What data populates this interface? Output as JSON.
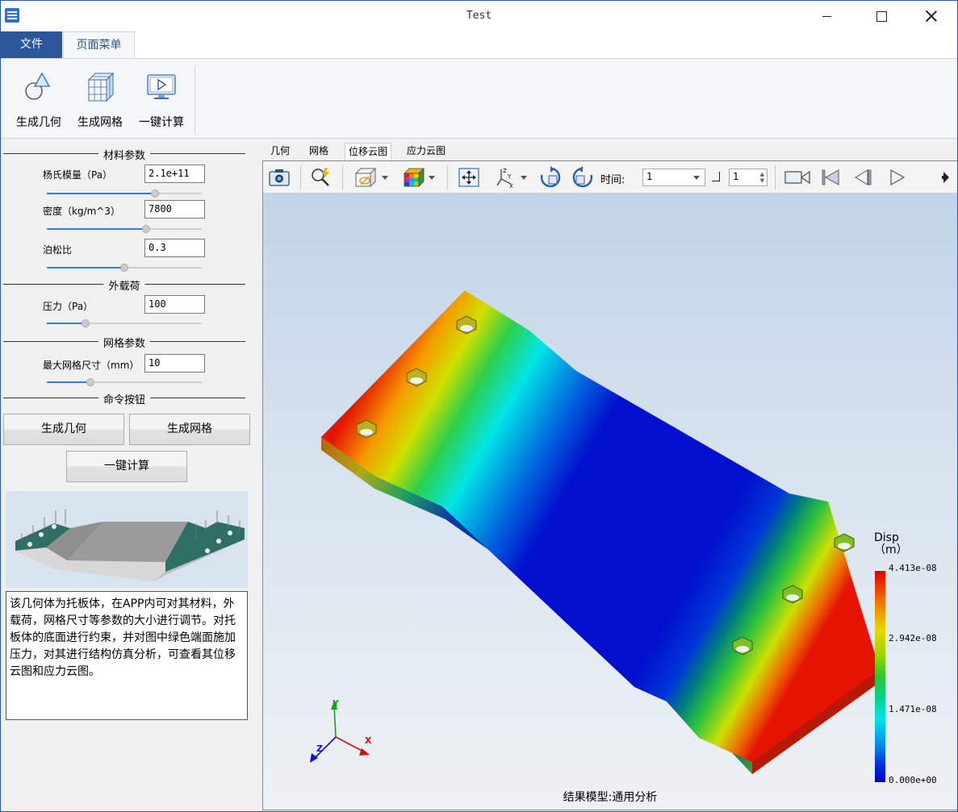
{
  "window": {
    "title": "Test"
  },
  "ribbon": {
    "tabs": [
      "文件",
      "页面菜单"
    ],
    "buttons": {
      "geometry": "生成几何",
      "mesh": "生成网格",
      "compute": "一键计算"
    }
  },
  "panel": {
    "material": {
      "title": "材料参数",
      "youngs_label": "杨氏模量（Pa）",
      "youngs_value": "2.1e+11",
      "youngs_level": 0.7,
      "density_label": "密度（kg/m^3）",
      "density_value": "7800",
      "density_level": 0.64,
      "poisson_label": "泊松比",
      "poisson_value": "0.3",
      "poisson_level": 0.5
    },
    "load": {
      "title": "外载荷",
      "pressure_label": "压力（Pa）",
      "pressure_value": "100",
      "pressure_level": 0.25
    },
    "mesh": {
      "title": "网格参数",
      "size_label": "最大网格尺寸（mm）",
      "size_value": "10",
      "size_level": 0.28
    },
    "commands": {
      "title": "命令按钮",
      "geometry": "生成几何",
      "mesh": "生成网格",
      "compute": "一键计算"
    },
    "description": "该几何体为托板体，在APP内可对其材料，外载荷，网格尺寸等参数的大小进行调节。对托板体的底面进行约束，并对图中绿色端面施加压力，对其进行结构仿真分析，可查看其位移云图和应力云图。"
  },
  "view": {
    "tabs": [
      "几何",
      "网格",
      "位移云图",
      "应力云图"
    ],
    "active_tab": "位移云图",
    "toolbar": {
      "time_label": "时间:",
      "time_value": "1",
      "step_value": "1"
    },
    "legend": {
      "title_line1": "Disp",
      "title_line2": "（m）",
      "values": [
        "4.413e-08",
        "2.942e-08",
        "1.471e-08",
        "0.000e+00"
      ]
    },
    "axes": {
      "x": "X",
      "y": "Y",
      "z": "Z"
    },
    "result_model": "结果模型:通用分析",
    "colors": {
      "max": "#e00000",
      "mid": "#2cc62c",
      "min": "#0000c8"
    }
  }
}
